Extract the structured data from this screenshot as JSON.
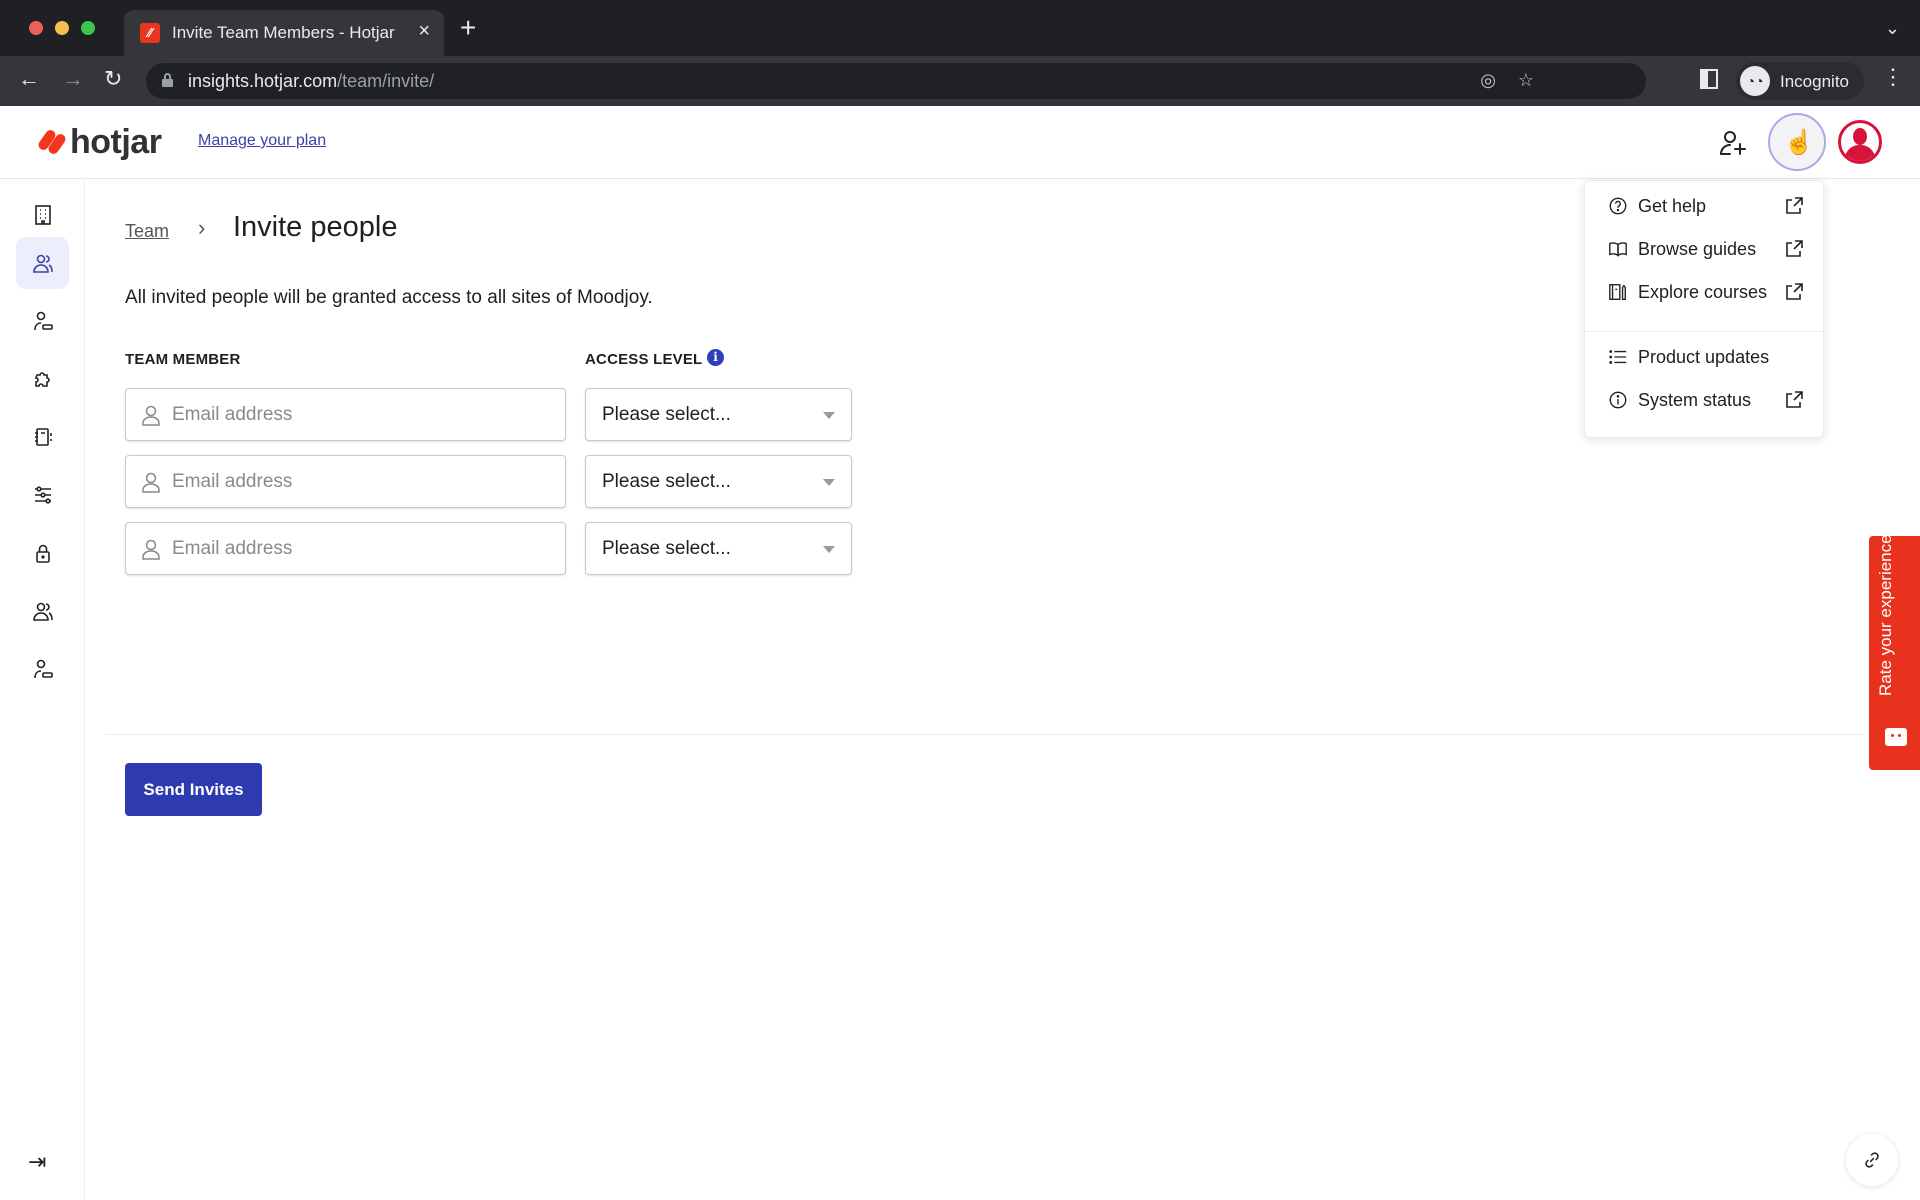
{
  "browser": {
    "tab_title": "Invite Team Members - Hotjar",
    "tab_close": "×",
    "new_tab": "+",
    "tab_dropdown": "⌄",
    "url_host": "insights.hotjar.com",
    "url_path": "/team/invite/",
    "nav_back": "←",
    "nav_forward": "→",
    "nav_reload": "↻",
    "eye_slash": "◎",
    "star": "☆",
    "profile_label": "Incognito",
    "incognito_glyph": "◔◔",
    "menu": "⋮"
  },
  "header": {
    "logo_text": "hotjar",
    "manage_plan": "Manage your plan",
    "help_glyph": "☝"
  },
  "sidebar": {
    "items": [
      {
        "name": "organization",
        "active": false
      },
      {
        "name": "team",
        "active": true
      },
      {
        "name": "user-settings",
        "active": false
      },
      {
        "name": "integrations",
        "active": false
      },
      {
        "name": "notebook",
        "active": false
      },
      {
        "name": "settings-sliders",
        "active": false
      },
      {
        "name": "security",
        "active": false
      },
      {
        "name": "team-2",
        "active": false
      },
      {
        "name": "user-settings-2",
        "active": false
      }
    ],
    "collapse_glyph": "⇥"
  },
  "main": {
    "breadcrumb_parent": "Team",
    "breadcrumb_separator": "›",
    "title": "Invite people",
    "info": "All invited people will be granted access to all sites of Moodjoy.",
    "col_team_member": "TEAM MEMBER",
    "col_access_level": "ACCESS LEVEL",
    "info_glyph": "i",
    "rows": [
      {
        "email_placeholder": "Email address",
        "email_value": "",
        "access": "Please select..."
      },
      {
        "email_placeholder": "Email address",
        "email_value": "",
        "access": "Please select..."
      },
      {
        "email_placeholder": "Email address",
        "email_value": "",
        "access": "Please select..."
      }
    ],
    "send_button": "Send Invites"
  },
  "help_menu": {
    "items": [
      {
        "label": "Get help",
        "external": true
      },
      {
        "label": "Browse guides",
        "external": true
      },
      {
        "label": "Explore courses",
        "external": true
      },
      {
        "label": "Product updates",
        "external": false
      },
      {
        "label": "System status",
        "external": true
      }
    ]
  },
  "feedback": {
    "rate_label": "Rate your experience"
  },
  "colors": {
    "brand_red": "#f4361e",
    "primary_button": "#2d3ab0",
    "link": "#3c40a8",
    "feedback_tab": "#e8321e",
    "avatar_red": "#d8133a"
  }
}
